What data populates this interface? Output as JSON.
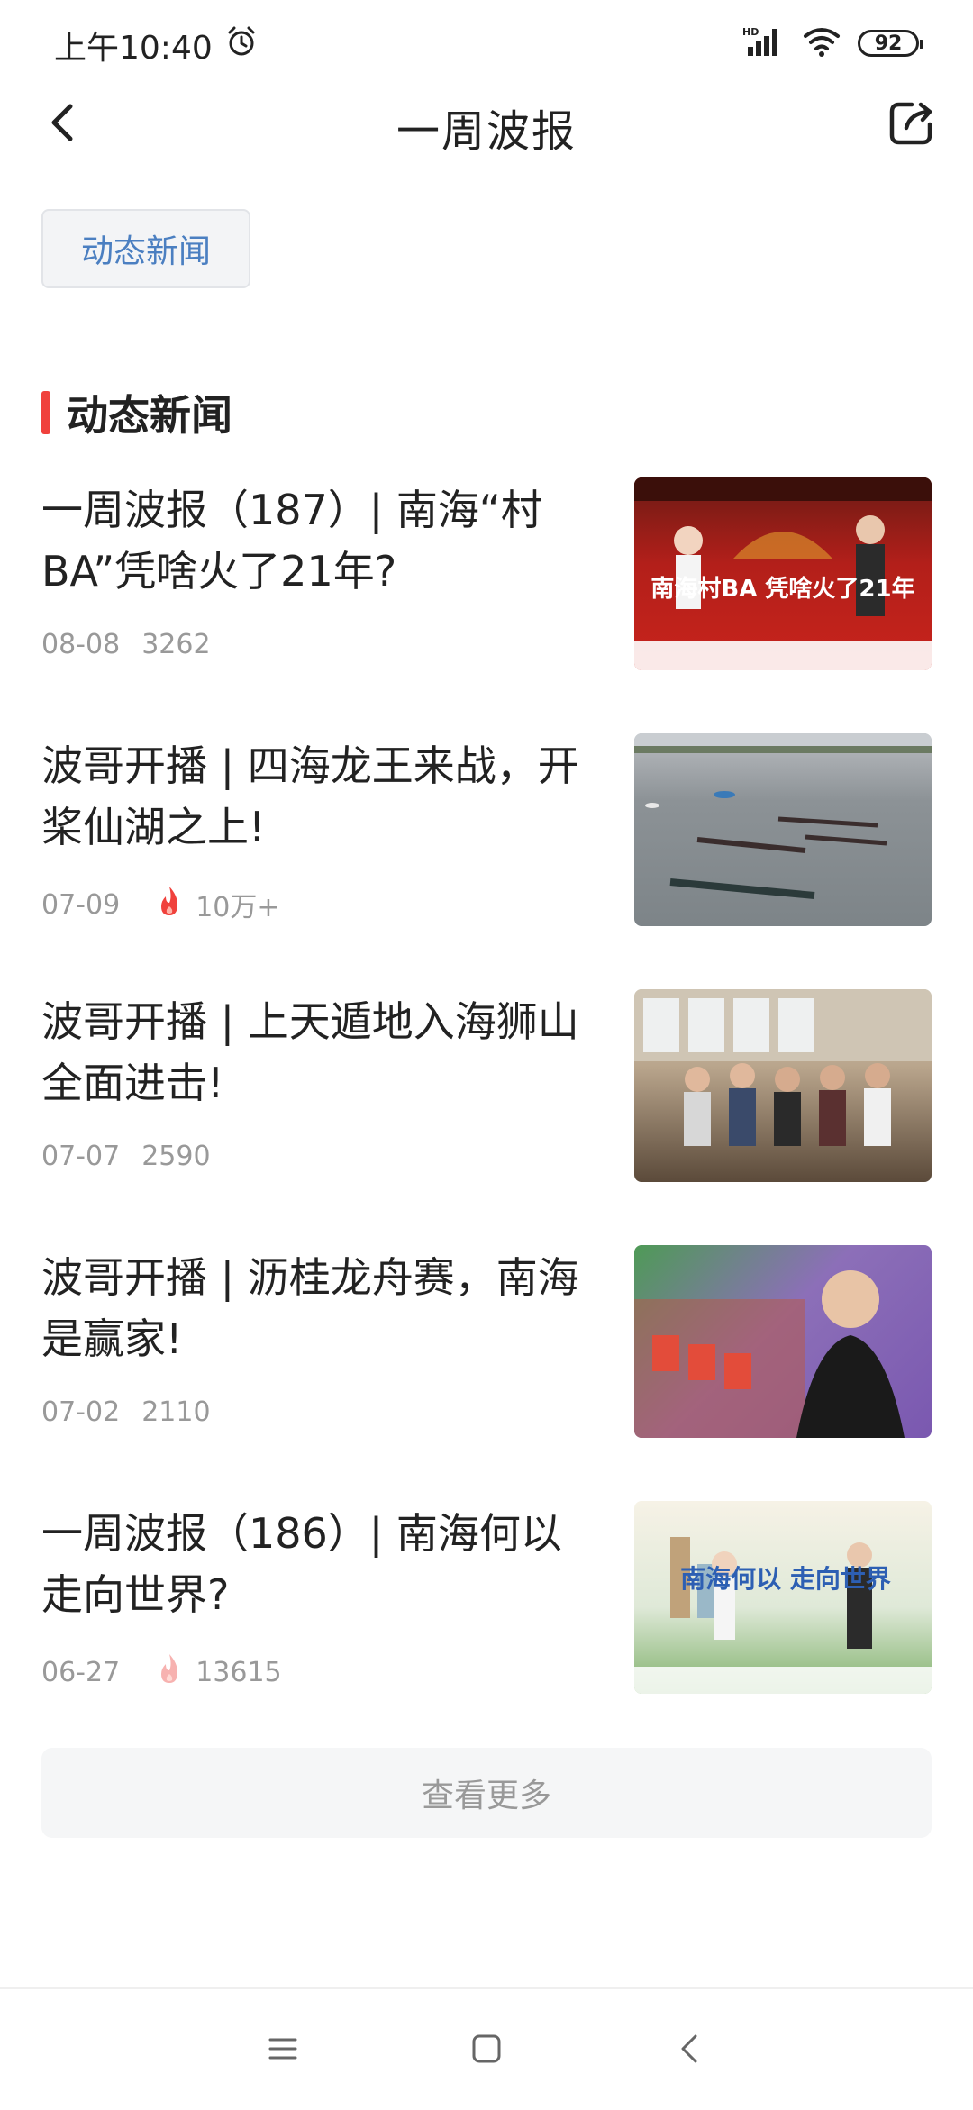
{
  "status_bar": {
    "time": "上午10:40",
    "battery": "92",
    "icons": [
      "alarm-icon",
      "hd-signal-icon",
      "wifi-icon",
      "battery-icon"
    ]
  },
  "header": {
    "title": "一周波报",
    "back_icon": "chevron-left-icon",
    "share_icon": "share-icon"
  },
  "tags": [
    {
      "label": "动态新闻"
    }
  ],
  "section": {
    "title": "动态新闻",
    "accent_color": "#f0413c"
  },
  "news": [
    {
      "title": "一周波报（187）| 南海“村BA”凭啥火了21年?",
      "date": "08-08",
      "count": "3262",
      "hot": false,
      "thumb_text": "南海村BA 凭啥火了21年"
    },
    {
      "title": "波哥开播 | 四海龙王来战，开桨仙湖之上!",
      "date": "07-09",
      "count": "10万+",
      "hot": true
    },
    {
      "title": "波哥开播 | 上天遁地入海狮山全面进击!",
      "date": "07-07",
      "count": "2590",
      "hot": false
    },
    {
      "title": "波哥开播 | 沥桂龙舟赛，南海是赢家!",
      "date": "07-02",
      "count": "2110",
      "hot": false
    },
    {
      "title": "一周波报（186）| 南海何以走向世界?",
      "date": "06-27",
      "count": "13615",
      "hot": true,
      "thumb_text": "南海何以 走向世界"
    }
  ],
  "load_more": "查看更多",
  "nav_bar": {
    "icons": [
      "menu-icon",
      "home-square-icon",
      "back-triangle-icon"
    ]
  },
  "colors": {
    "tag_text": "#4b7fc1",
    "hot": "#f0413c",
    "meta": "#999999"
  }
}
